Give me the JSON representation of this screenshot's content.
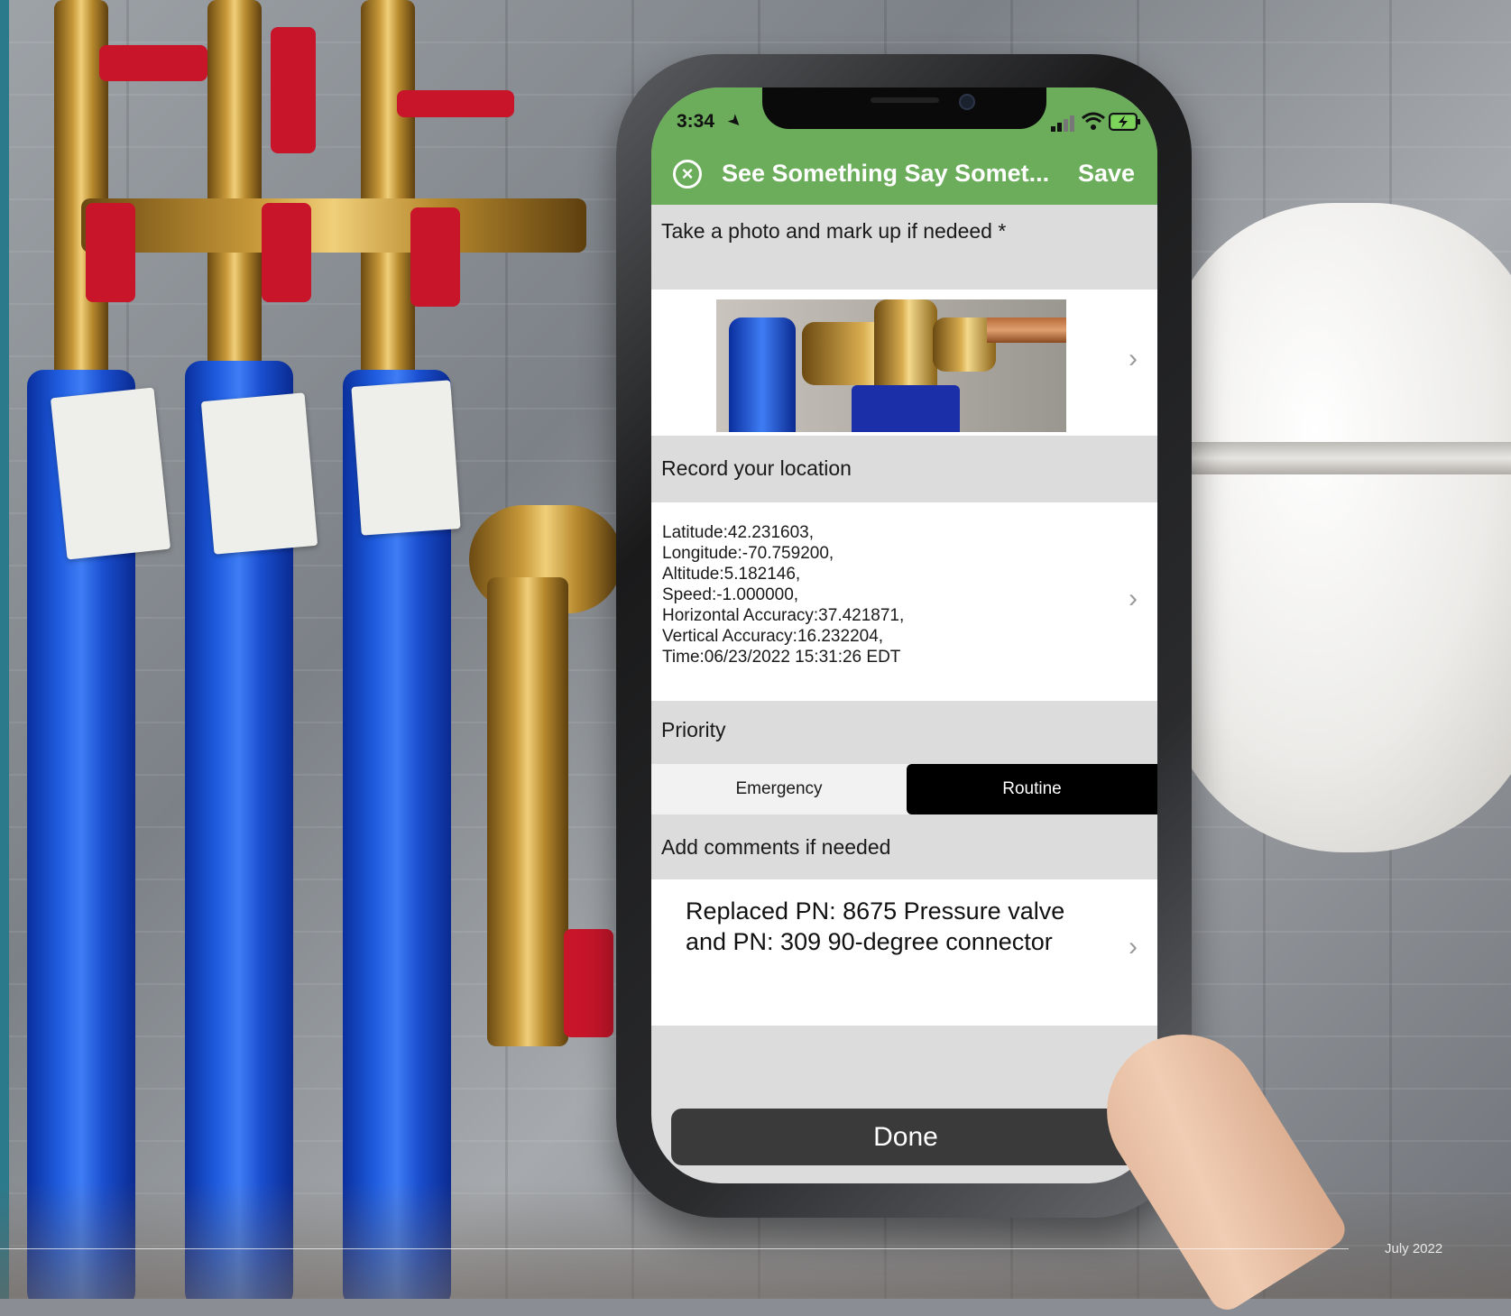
{
  "status_bar": {
    "time": "3:34"
  },
  "nav": {
    "title": "See Something Say Somet...",
    "save_label": "Save",
    "close_icon": "close-circle-icon"
  },
  "photo_section": {
    "label": "Take a photo and mark up if nedeed *"
  },
  "location_section": {
    "label": "Record your location",
    "lines": [
      "Latitude:42.231603,",
      "Longitude:-70.759200,",
      "Altitude:5.182146,",
      "Speed:-1.000000,",
      "Horizontal Accuracy:37.421871,",
      "Vertical Accuracy:16.232204,",
      "Time:06/23/2022 15:31:26 EDT"
    ]
  },
  "priority_section": {
    "label": "Priority",
    "options": [
      "Emergency",
      "Routine"
    ],
    "selected": "Routine"
  },
  "comments_section": {
    "label": "Add comments if needed",
    "lines": [
      "Replaced PN: 8675 Pressure valve",
      "and PN: 309 90-degree connector"
    ]
  },
  "done_label": "Done",
  "footer": {
    "date": "July 2022"
  },
  "colors": {
    "header_green": "#6bad5a",
    "selected_segment": "#000000",
    "done_button": "#3a3a3a"
  }
}
